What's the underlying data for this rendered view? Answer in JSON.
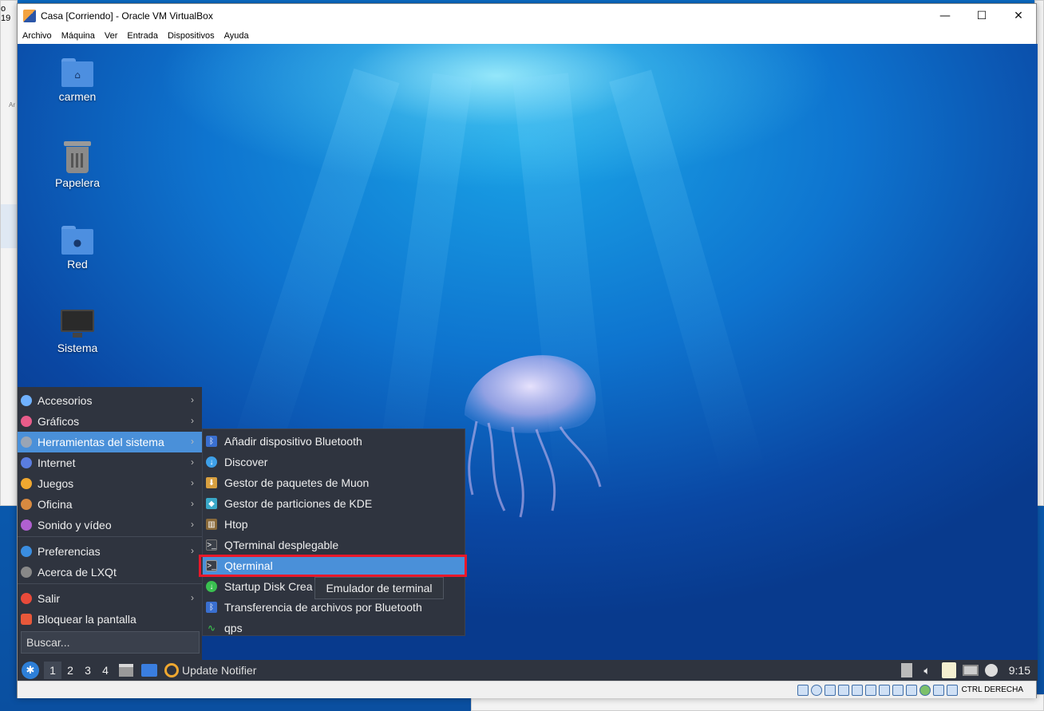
{
  "window": {
    "title": "Casa [Corriendo] - Oracle VM VirtualBox",
    "min": "—",
    "max": "☐",
    "close": "✕"
  },
  "menubar": [
    "Archivo",
    "Máquina",
    "Ver",
    "Entrada",
    "Dispositivos",
    "Ayuda"
  ],
  "host_fragments": {
    "top_left": "o 19",
    "left_a": "Ar"
  },
  "desktop": {
    "icons": [
      {
        "label": "carmen",
        "icon": "home-folder-icon"
      },
      {
        "label": "Papelera",
        "icon": "trash-icon"
      },
      {
        "label": "Red",
        "icon": "network-folder-icon"
      },
      {
        "label": "Sistema",
        "icon": "computer-icon"
      }
    ]
  },
  "start_menu": {
    "items": [
      {
        "label": "Accesorios",
        "icon": "accessories-icon",
        "color": "#6fb1ff",
        "arrow": "›"
      },
      {
        "label": "Gráficos",
        "icon": "graphics-icon",
        "color": "#e85c8a",
        "arrow": "›"
      },
      {
        "label": "Herramientas del sistema",
        "icon": "system-tools-icon",
        "color": "#9aa5b5",
        "arrow": "›"
      },
      {
        "label": "Internet",
        "icon": "internet-icon",
        "color": "#5a7de0",
        "arrow": "›"
      },
      {
        "label": "Juegos",
        "icon": "games-icon",
        "color": "#f0a830",
        "arrow": "›"
      },
      {
        "label": "Oficina",
        "icon": "office-icon",
        "color": "#d88a40",
        "arrow": "›"
      },
      {
        "label": "Sonido y vídeo",
        "icon": "sound-video-icon",
        "color": "#b060d0",
        "arrow": "›"
      },
      {
        "label": "Preferencias",
        "icon": "preferences-icon",
        "color": "#3a8de0",
        "arrow": "›"
      },
      {
        "label": "Acerca de LXQt",
        "icon": "about-icon",
        "color": "#888888",
        "arrow": ""
      },
      {
        "label": "Salir",
        "icon": "power-icon",
        "color": "#e84a3a",
        "arrow": "›"
      },
      {
        "label": "Bloquear la pantalla",
        "icon": "lock-icon",
        "color": "#e8583a",
        "arrow": ""
      }
    ],
    "search_placeholder": "Buscar..."
  },
  "submenu": {
    "items": [
      {
        "label": "Añadir dispositivo Bluetooth",
        "icon": "bluetooth-icon",
        "color": "#3a6fd0",
        "glyph": "ᛒ"
      },
      {
        "label": "Discover",
        "icon": "discover-icon",
        "color": "#3ea0e8",
        "glyph": "↓"
      },
      {
        "label": "Gestor de paquetes de Muon",
        "icon": "muon-icon",
        "color": "#d8a040",
        "glyph": "⬇"
      },
      {
        "label": "Gestor de particiones de KDE",
        "icon": "partition-icon",
        "color": "#3aa8c8",
        "glyph": "◆"
      },
      {
        "label": "Htop",
        "icon": "htop-icon",
        "color": "#8a6a3a",
        "glyph": "▥"
      },
      {
        "label": "QTerminal desplegable",
        "icon": "terminal-dropdown-icon",
        "color": "#3a3f48",
        "glyph": ">_"
      },
      {
        "label": "Qterminal",
        "icon": "terminal-icon",
        "color": "#3a3f48",
        "glyph": ">_"
      },
      {
        "label": "Startup Disk Crea",
        "icon": "startup-disk-icon",
        "color": "#3ac050",
        "glyph": "↓"
      },
      {
        "label": "Transferencia de archivos por Bluetooth",
        "icon": "bluetooth-transfer-icon",
        "color": "#3a6fd0",
        "glyph": "ᛒ"
      },
      {
        "label": "qps",
        "icon": "qps-icon",
        "color": "#2f343f",
        "glyph": "∿"
      }
    ],
    "tooltip": "Emulador de terminal"
  },
  "panel": {
    "workspaces": [
      "1",
      "2",
      "3",
      "4"
    ],
    "task": "Update Notifier",
    "clock": "9:15"
  },
  "statusbar": {
    "host_key": "CTRL DERECHA"
  },
  "colors": {
    "highlight": "#e8182a",
    "selection": "#4a90d9",
    "menu_bg": "#2f343f"
  }
}
